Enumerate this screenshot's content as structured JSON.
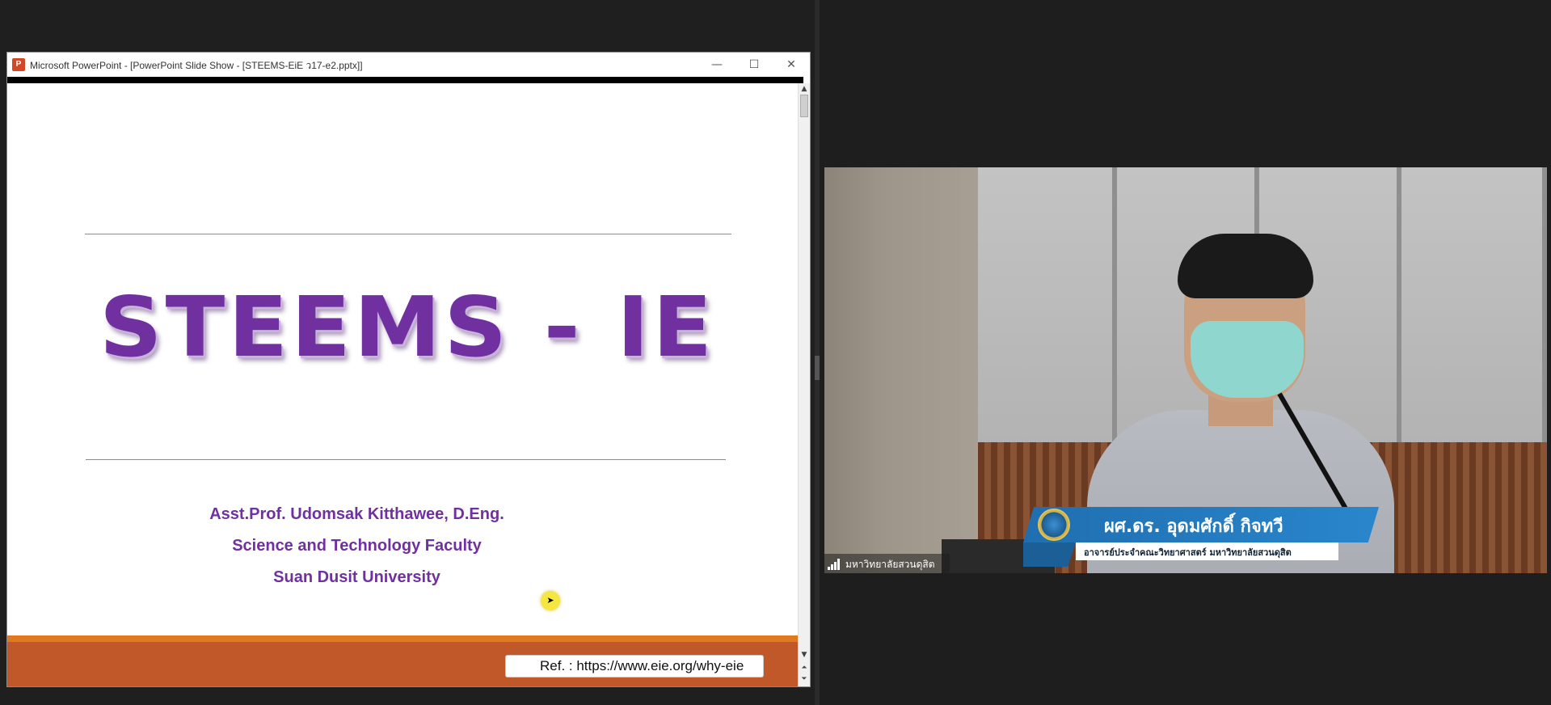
{
  "ppt_window": {
    "title": "Microsoft PowerPoint - [PowerPoint Slide Show - [STEEMS-EiE ว17-e2.pptx]]",
    "icon": "powerpoint-icon",
    "minimize_glyph": "—",
    "maximize_glyph": "☐",
    "close_glyph": "✕"
  },
  "slide": {
    "title": "STEEMS - IE",
    "author": "Asst.Prof. Udomsak Kitthawee, D.Eng.",
    "faculty": "Science and Technology Faculty",
    "university": "Suan Dusit University",
    "reference": "Ref. : https://www.eie.org/why-eie",
    "cursor_glyph": "➤"
  },
  "scrollbar": {
    "up_glyph": "▲",
    "down_glyph": "▼",
    "prev_glyph": "⏶",
    "next_glyph": "⏷"
  },
  "video": {
    "presenter_name": "ผศ.ดร. อุดมศักดิ์ กิจทวี",
    "presenter_role": "อาจารย์ประจำคณะวิทยาศาสตร์ มหาวิทยาลัยสวนดุสิต",
    "org_label": "มหาวิทยาลัยสวนดุสิต",
    "signal_icon": "signal-strength-icon"
  },
  "colors": {
    "slide_title": "#7030a0",
    "orange_band": "#e07a1f",
    "rust_band": "#c0582a",
    "nameplate_blue": "#2a86cc"
  }
}
